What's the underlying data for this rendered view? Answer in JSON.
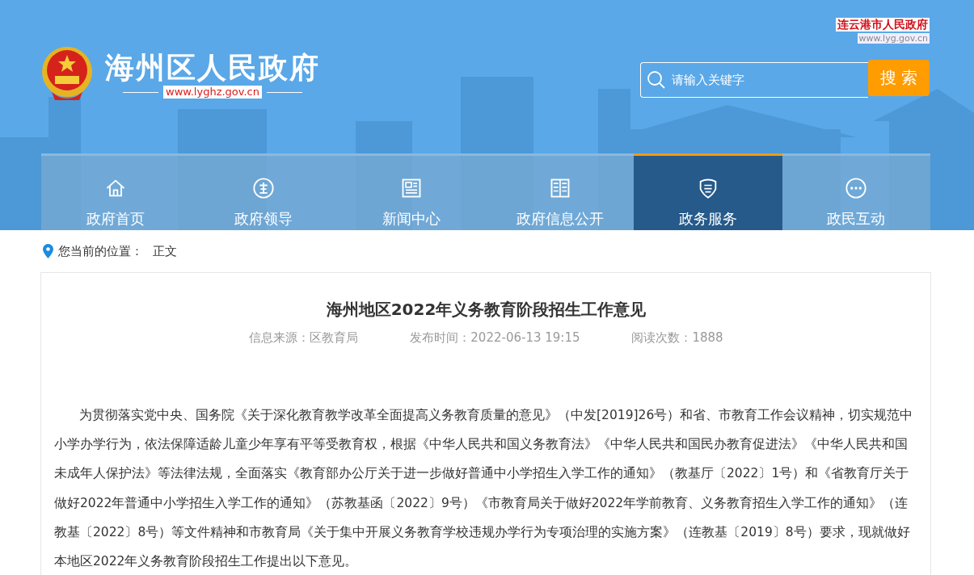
{
  "header": {
    "site_name": "海州区人民政府",
    "site_url": "www.lyghz.gov.cn",
    "parent_site_name": "连云港市人民政府",
    "parent_site_url": "www.lyg.gov.cn",
    "search": {
      "placeholder": "请输入关键字",
      "button": "搜 索"
    }
  },
  "nav": [
    {
      "label": "政府首页",
      "kind": "home",
      "selected": false
    },
    {
      "label": "政府领导",
      "kind": "leader",
      "selected": false
    },
    {
      "label": "新闻中心",
      "kind": "news",
      "selected": false
    },
    {
      "label": "政府信息公开",
      "kind": "book",
      "selected": false
    },
    {
      "label": "政务服务",
      "kind": "shield",
      "selected": true
    },
    {
      "label": "政民互动",
      "kind": "chat",
      "selected": false
    }
  ],
  "breadcrumb": {
    "label": "您当前的位置：",
    "current": "正文"
  },
  "article": {
    "title": "海州地区2022年义务教育阶段招生工作意见",
    "meta": [
      "信息来源：区教育局",
      "发布时间：2022-06-13 19:15",
      "阅读次数：1888"
    ],
    "paragraphs": [
      "为贯彻落实党中央、国务院《关于深化教育教学改革全面提高义务教育质量的意见》（中发[2019]26号）和省、市教育工作会议精神，切实规范中小学办学行为，依法保障适龄儿童少年享有平等受教育权，根据《中华人民共和国义务教育法》《中华人民共和国民办教育促进法》《中华人民共和国未成年人保护法》等法律法规，全面落实《教育部办公厅关于进一步做好普通中小学招生入学工作的通知》（教基厅〔2022〕1号）和《省教育厅关于做好2022年普通中小学招生入学工作的通知》（苏教基函〔2022〕9号）《市教育局关于做好2022年学前教育、义务教育招生入学工作的通知》（连教基〔2022〕8号）等文件精神和市教育局《关于集中开展义务教育学校违规办学行为专项治理的实施方案》（连教基〔2019〕8号）要求，现就做好本地区2022年义务教育阶段招生工作提出以下意见。"
    ]
  }
}
